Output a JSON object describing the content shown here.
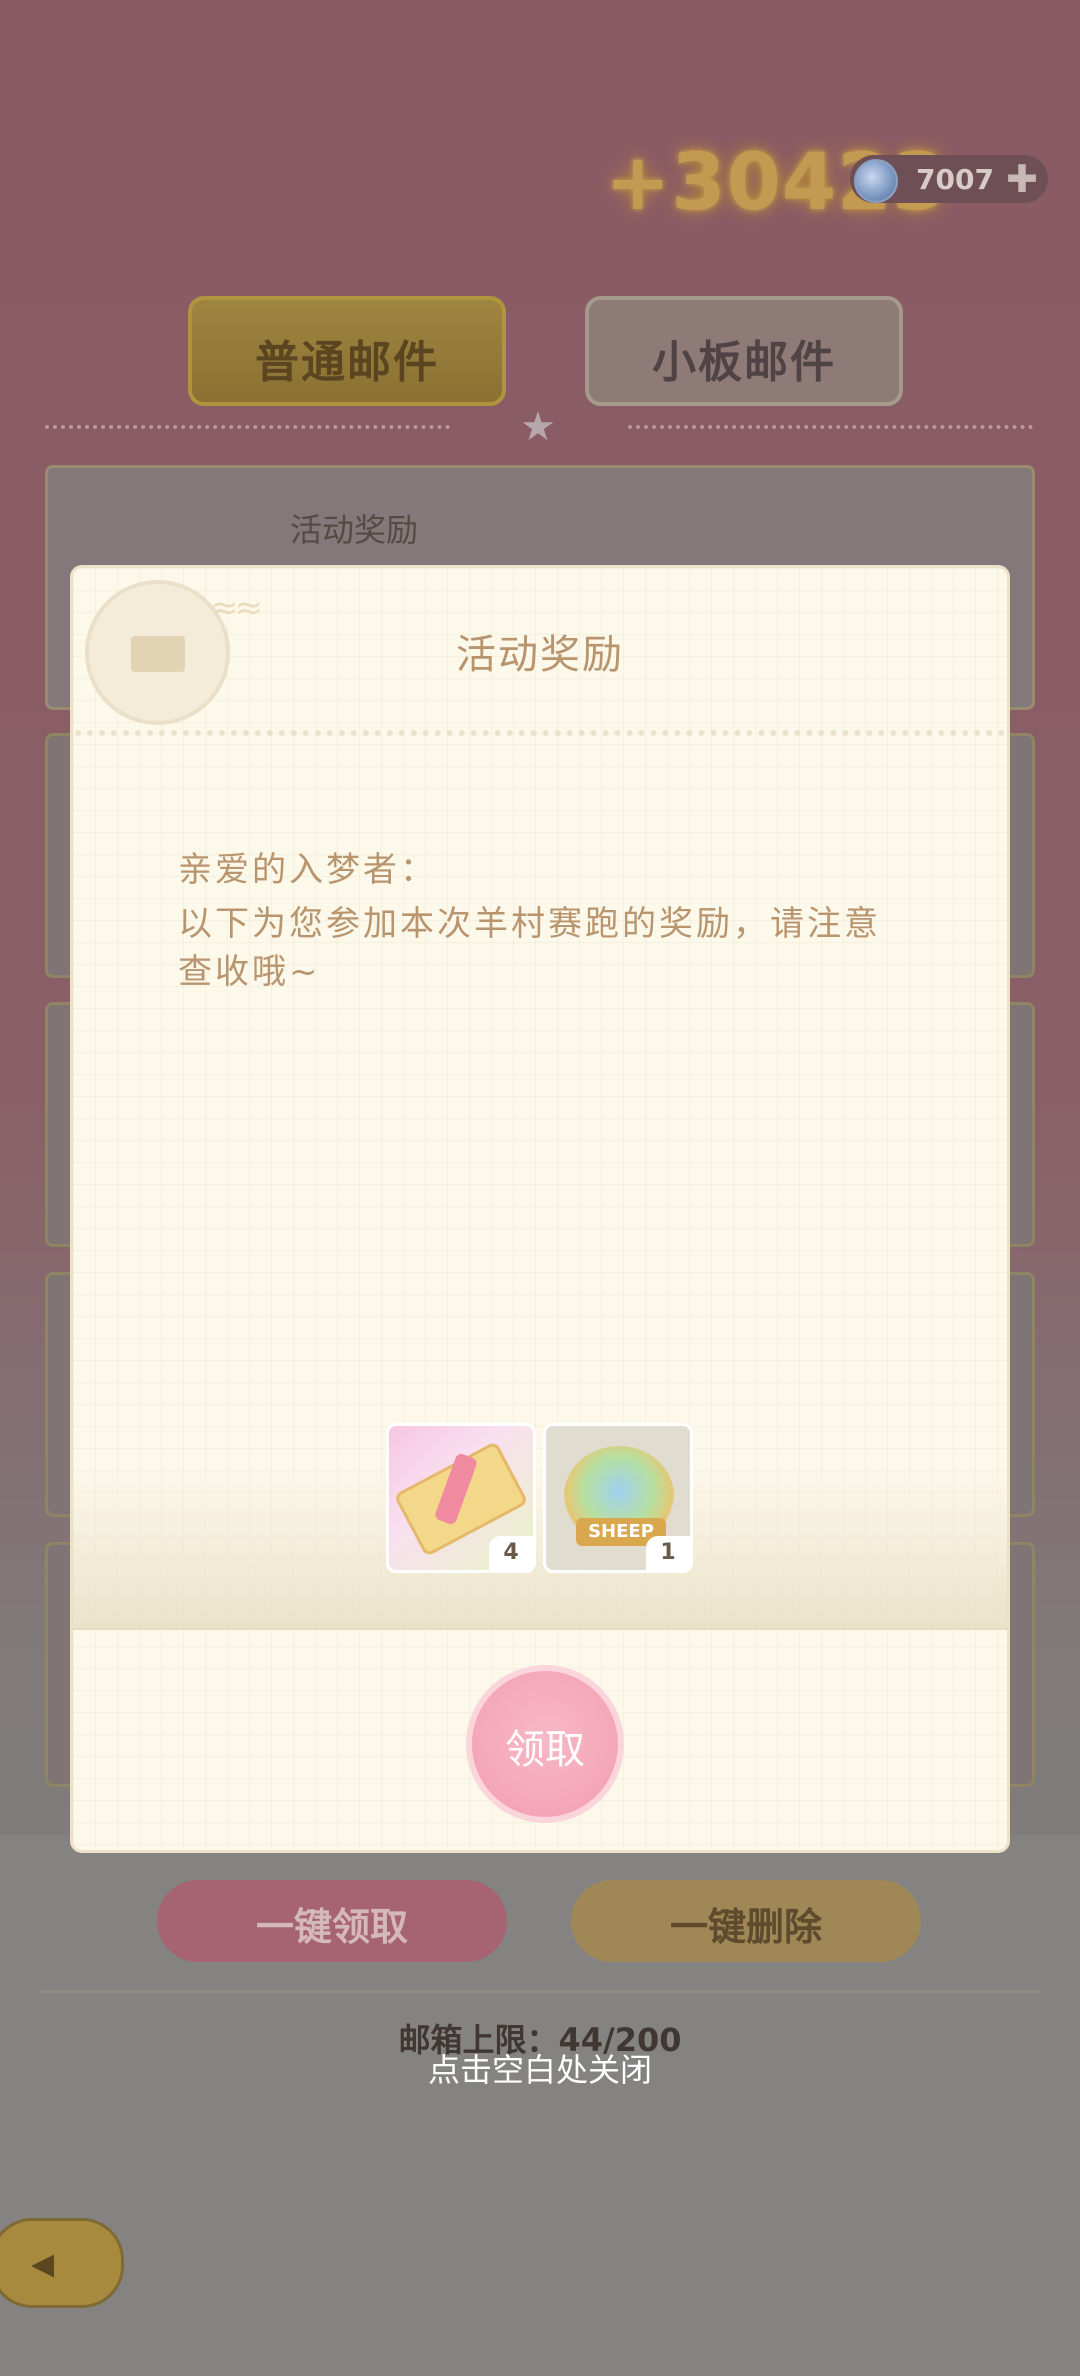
{
  "top": {
    "bonus_text": "+30423",
    "currency_amount": "7007",
    "currency_icon": "star-gem-icon",
    "add_icon": "plus-icon"
  },
  "tabs": [
    {
      "label": "普通邮件",
      "active": true
    },
    {
      "label": "小板邮件",
      "active": false
    }
  ],
  "mail_list": {
    "first_item_title": "活动奖励"
  },
  "footer": {
    "claim_all": "一键领取",
    "delete_all": "一键删除",
    "mailbox_limit": "邮箱上限：44/200",
    "close_hint": "点击空白处关闭"
  },
  "modal": {
    "title": "活动奖励",
    "greeting": "亲爱的入梦者：",
    "body": "以下为您参加本次羊村赛跑的奖励，请注意查收哦~",
    "rewards": [
      {
        "name": "ticket",
        "count": "4"
      },
      {
        "name": "sheep-badge",
        "count": "1",
        "badge_text": "SHEEP"
      }
    ],
    "claim_button": "领取"
  },
  "colors": {
    "accent_gold": "#c39a52",
    "claim_pink": "#f4a6b7",
    "text_brown": "#b8956e"
  }
}
